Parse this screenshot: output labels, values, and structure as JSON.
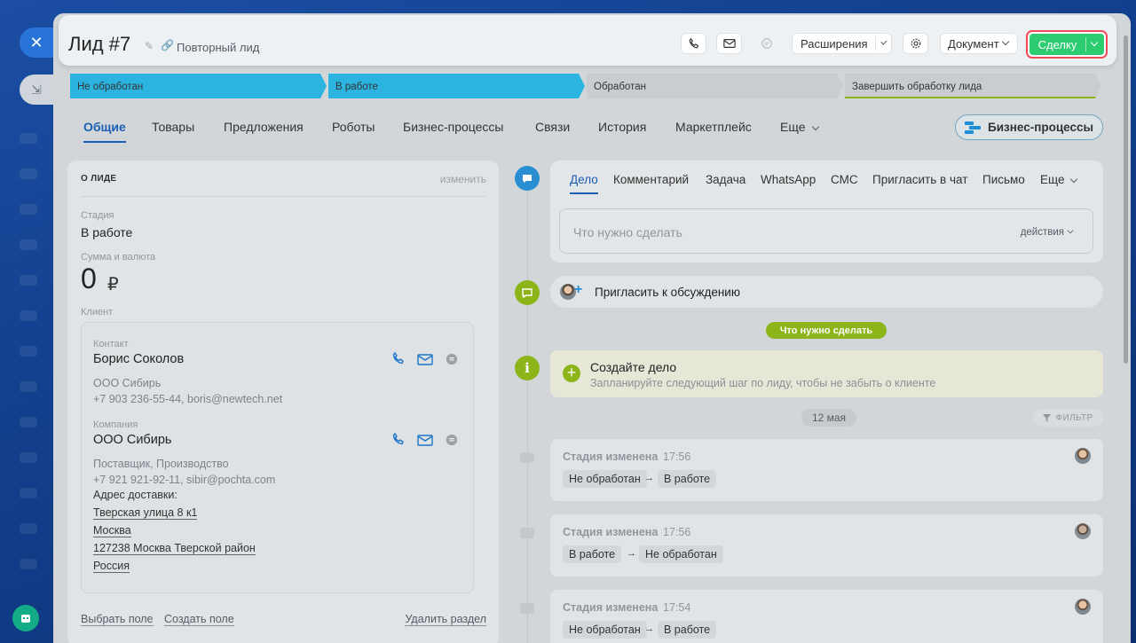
{
  "header": {
    "title": "Лид #7",
    "subtitle": "Повторный лид",
    "extensions_label": "Расширения",
    "document_label": "Документ",
    "deal_label": "Сделку",
    "accent": "#2ecc71",
    "highlight": "#f14b58"
  },
  "stages": [
    {
      "label": "Не обработан",
      "color": "#2bb4e0"
    },
    {
      "label": "В работе",
      "color": "#2bb4e0"
    },
    {
      "label": "Обработан",
      "color": "#c9cdd1"
    },
    {
      "label": "Завершить обработку лида",
      "color": "#c9cdd1",
      "underline": "#8db51a"
    }
  ],
  "tabs": [
    "Общие",
    "Товары",
    "Предложения",
    "Роботы",
    "Бизнес-процессы",
    "Связи",
    "История",
    "Маркетплейс",
    "Еще"
  ],
  "bp_button": "Бизнес-процессы",
  "about": {
    "heading": "О ЛИДЕ",
    "edit": "изменить",
    "stage_label": "Стадия",
    "stage_value": "В работе",
    "sum_label": "Сумма и валюта",
    "sum_value": "0",
    "currency": "₽",
    "client_label": "Клиент",
    "contact": {
      "label": "Контакт",
      "name": "Борис Соколов",
      "company": "ООО Сибирь",
      "phone_email": "+7 903 236-55-44, boris@newtech.net"
    },
    "company": {
      "label": "Компания",
      "name": "ООО Сибирь",
      "type": "Поставщик, Производство",
      "phone_email": "+7 921 921-92-11, sibir@pochta.com",
      "address_label": "Адрес доставки:",
      "address": [
        "Тверская улица 8 к1",
        "Москва",
        "127238 Москва Тверской район",
        "Россия"
      ]
    },
    "footer": {
      "select_field": "Выбрать поле",
      "create_field": "Создать поле",
      "delete_section": "Удалить раздел"
    }
  },
  "composer": {
    "tabs": [
      "Дело",
      "Комментарий",
      "Задача",
      "WhatsApp",
      "СМС",
      "Пригласить в чат",
      "Письмо",
      "Еще"
    ],
    "placeholder": "Что нужно сделать",
    "actions": "действия"
  },
  "invite": "Пригласить к обсуждению",
  "todo_pill": "Что нужно сделать",
  "todo": {
    "title": "Создайте дело",
    "hint": "Запланируйте следующий шаг по лиду, чтобы не забыть о клиенте"
  },
  "date_pill": "12 мая",
  "filter": "ФИЛЬТР",
  "events": [
    {
      "title": "Стадия изменена",
      "time": "17:56",
      "from": "Не обработан",
      "to": "В работе"
    },
    {
      "title": "Стадия изменена",
      "time": "17:56",
      "from": "В работе",
      "to": "Не обработан"
    },
    {
      "title": "Стадия изменена",
      "time": "17:54",
      "from": "Не обработан",
      "to": "В работе"
    }
  ],
  "icons": {
    "close": "close-icon",
    "minimize": "minimize-icon",
    "phone": "phone-icon",
    "mail": "mail-icon",
    "chat": "chat-icon",
    "gear": "gear-icon",
    "pen": "pencil-icon",
    "link": "link-icon",
    "bot": "bot-icon"
  }
}
